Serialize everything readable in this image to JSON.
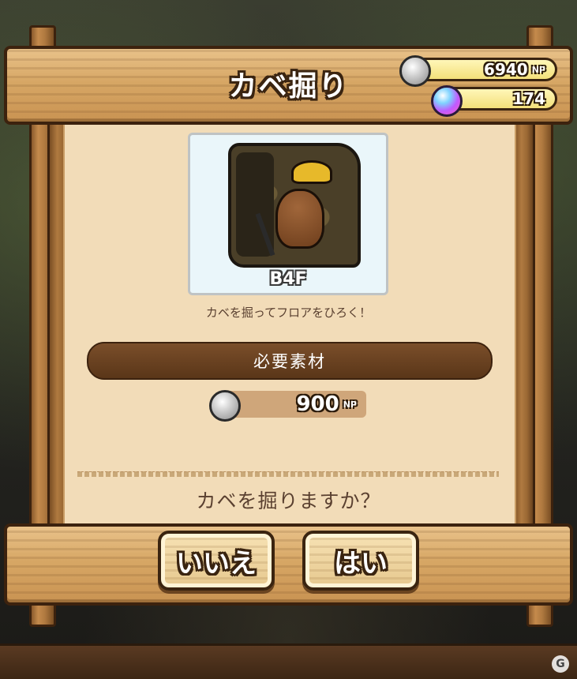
{
  "dialog": {
    "title": "カベ掘り",
    "description": "カベを掘ってフロアをひろく！",
    "question": "カベを掘りますか？"
  },
  "currency": {
    "np_value": "6940",
    "np_unit": "NP",
    "gem_value": "174"
  },
  "preview": {
    "floor_label": "B4F"
  },
  "requirements": {
    "header": "必要素材",
    "cost_value": "900",
    "cost_unit": "NP"
  },
  "buttons": {
    "no_label": "いいえ",
    "yes_label": "はい"
  },
  "colors": {
    "wood_light": "#e9c28a",
    "wood_outline": "#3c220e",
    "panel_bg": "#f2dcb8",
    "requirement_bar": "#6a4220",
    "text_brown": "#5a4030"
  },
  "icons": [
    "np-coin-icon",
    "gem-orb-icon",
    "mole-miner-illustration"
  ]
}
